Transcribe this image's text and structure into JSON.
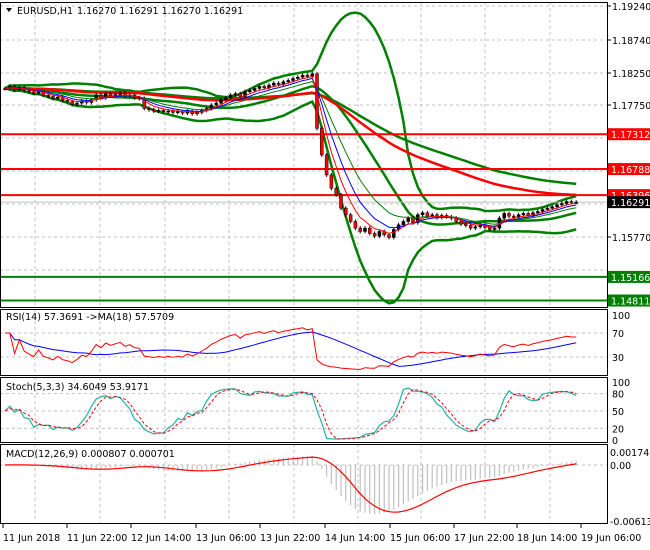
{
  "header": {
    "symbol": "EURUSD,H1",
    "ohlc": "1.16270 1.16291 1.16270 1.16291"
  },
  "colors": {
    "up": "#000000",
    "down": "#ff0000",
    "bands": "#008000",
    "rsi": "#ff0000",
    "rsi_ma": "#0000ff",
    "stoch_main": "#20b2aa",
    "stoch_signal": "#ff0000",
    "macd_hist": "#c0c0c0",
    "macd_signal": "#ff0000",
    "grid": "#c0c0c0"
  },
  "chart_data": [
    {
      "type": "candlestick",
      "title": "EURUSD,H1",
      "ylim": [
        1.1475,
        1.1935
      ],
      "price_ticks": [
        "1.19240",
        "1.18740",
        "1.18250",
        "1.17750",
        "1.15770"
      ],
      "current_price": "1.16291",
      "levels": [
        {
          "value": 1.17312,
          "label": "1.17312",
          "color": "#ff0000"
        },
        {
          "value": 1.16788,
          "label": "1.16788",
          "color": "#ff0000"
        },
        {
          "value": 1.16396,
          "label": "1.16396",
          "color": "#ff0000"
        },
        {
          "value": 1.15166,
          "label": "1.15166",
          "color": "#008000"
        },
        {
          "value": 1.14811,
          "label": "1.14811",
          "color": "#008000"
        }
      ],
      "closes": [
        1.18,
        1.1803,
        1.1798,
        1.1802,
        1.1797,
        1.1795,
        1.1793,
        1.1796,
        1.179,
        1.1788,
        1.1785,
        1.1787,
        1.1782,
        1.178,
        1.1776,
        1.1778,
        1.1781,
        1.1779,
        1.1783,
        1.179,
        1.1786,
        1.1792,
        1.1789,
        1.1791,
        1.1793,
        1.1788,
        1.179,
        1.1786,
        1.1785,
        1.177,
        1.1768,
        1.1766,
        1.1767,
        1.1765,
        1.1766,
        1.1764,
        1.1765,
        1.1763,
        1.1766,
        1.1762,
        1.1764,
        1.1767,
        1.177,
        1.1775,
        1.1778,
        1.1783,
        1.1786,
        1.179,
        1.1792,
        1.1788,
        1.1795,
        1.1797,
        1.18,
        1.1803,
        1.1801,
        1.1805,
        1.1808,
        1.1806,
        1.181,
        1.1812,
        1.1815,
        1.1817,
        1.182,
        1.1818,
        1.1822,
        1.174,
        1.17,
        1.167,
        1.165,
        1.164,
        1.162,
        1.161,
        1.16,
        1.159,
        1.1585,
        1.159,
        1.1582,
        1.1578,
        1.1585,
        1.158,
        1.1576,
        1.1588,
        1.1595,
        1.16,
        1.1605,
        1.1598,
        1.161,
        1.1613,
        1.1608,
        1.161,
        1.1606,
        1.1609,
        1.1607,
        1.1605,
        1.16,
        1.1596,
        1.1594,
        1.159,
        1.1592,
        1.1595,
        1.1591,
        1.1588,
        1.159,
        1.1605,
        1.1612,
        1.1608,
        1.1606,
        1.161,
        1.1612,
        1.1609,
        1.1613,
        1.1615,
        1.1618,
        1.162,
        1.1622,
        1.1625,
        1.1627,
        1.163,
        1.1629,
        1.1629
      ]
    },
    {
      "type": "line",
      "title": "RSI(14) 57.3691  ->MA(18) 57.5709",
      "ylim": [
        0,
        100
      ],
      "ticks": [
        "100",
        "70",
        "30"
      ]
    },
    {
      "type": "line",
      "title": "Stoch(5,3,3) 34.6049 53.9171",
      "ylim": [
        0,
        100
      ],
      "ticks": [
        "100",
        "80",
        "50",
        "20",
        "0"
      ]
    },
    {
      "type": "bar",
      "title": "MACD(12,26,9) 0.000807 0.000701",
      "ylim": [
        -0.006133,
        0.001742
      ],
      "ticks": [
        "0.001742",
        "0.00",
        "-0.006133"
      ]
    }
  ],
  "time_axis": [
    "11 Jun 2018",
    "11 Jun 22:00",
    "12 Jun 14:00",
    "13 Jun 06:00",
    "13 Jun 22:00",
    "14 Jun 14:00",
    "15 Jun 06:00",
    "17 Jun 22:00",
    "18 Jun 14:00",
    "19 Jun 06:00"
  ]
}
